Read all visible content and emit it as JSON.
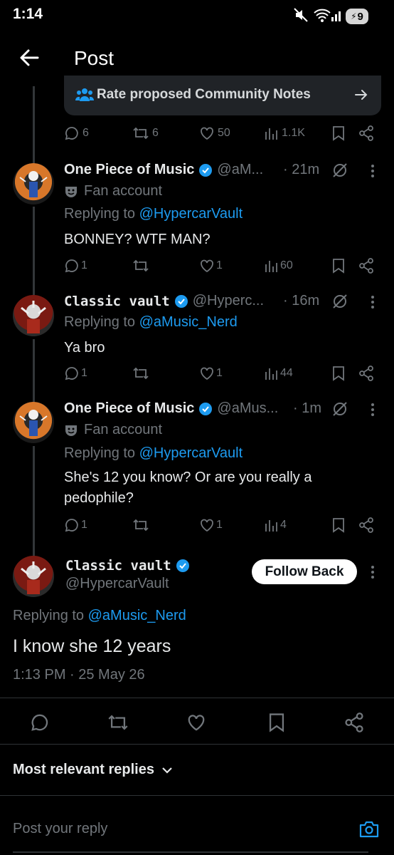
{
  "status_bar": {
    "time": "1:14",
    "battery": "9"
  },
  "header": {
    "title": "Post"
  },
  "community_notes": {
    "label": "Rate proposed Community Notes"
  },
  "parent_actions": {
    "replies": "6",
    "reposts": "6",
    "likes": "50",
    "views": "1.1K"
  },
  "replies": [
    {
      "name": "One Piece of Music",
      "handle": "@aM...",
      "time": "· 21m",
      "badge": "Fan account",
      "replying_prefix": "Replying to",
      "replying_to": "@HypercarVault",
      "text": "BONNEY? WTF MAN?",
      "replies": "1",
      "reposts": "",
      "likes": "1",
      "views": "60"
    },
    {
      "name": "Classic vault",
      "handle": "@Hyperc...",
      "time": "· 16m",
      "replying_prefix": "Replying to",
      "replying_to": "@aMusic_Nerd",
      "text": "Ya bro",
      "replies": "1",
      "reposts": "",
      "likes": "1",
      "views": "44"
    },
    {
      "name": "One Piece of Music",
      "handle": "@aMus...",
      "time": "· 1m",
      "badge": "Fan account",
      "replying_prefix": "Replying to",
      "replying_to": "@HypercarVault",
      "text_line1": "She's 12 you know? Or are you really a",
      "text_line2": "pedophile?",
      "replies": "1",
      "reposts": "",
      "likes": "1",
      "views": "4"
    }
  ],
  "main_post": {
    "name": "Classic vault",
    "handle": "@HypercarVault",
    "follow_label": "Follow Back",
    "replying_prefix": "Replying to",
    "replying_to": "@aMusic_Nerd",
    "text": "I know she 12 years",
    "timestamp": "1:13 PM · 25 May 26"
  },
  "sort": {
    "label": "Most relevant replies"
  },
  "composer": {
    "placeholder": "Post your reply"
  },
  "colors": {
    "accent": "#1d9bf0",
    "background": "#000000",
    "muted": "#71767b",
    "verified": "#1d9bf0"
  }
}
